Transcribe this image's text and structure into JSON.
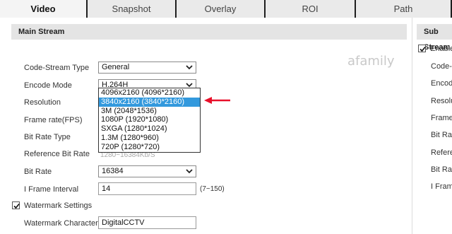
{
  "tabs": [
    "Video",
    "Snapshot",
    "Overlay",
    "ROI",
    "Path"
  ],
  "main_stream": {
    "title": "Main Stream",
    "code_stream_type": {
      "label": "Code-Stream Type",
      "value": "General"
    },
    "encode_mode": {
      "label": "Encode Mode",
      "value": "H.264H"
    },
    "resolution": {
      "label": "Resolution"
    },
    "frame_rate": {
      "label": "Frame rate(FPS)"
    },
    "bit_rate_type": {
      "label": "Bit Rate Type"
    },
    "reference_bit_rate": {
      "label": "Reference Bit Rate",
      "value": "1280~16384Kb/S"
    },
    "bit_rate": {
      "label": "Bit Rate",
      "value": "16384"
    },
    "i_frame_interval": {
      "label": "I Frame Interval",
      "value": "14",
      "range": "(7~150)"
    },
    "watermark_settings": {
      "label": "Watermark Settings",
      "checked": true
    },
    "watermark_character": {
      "label": "Watermark Character",
      "value": "DigitalCCTV"
    }
  },
  "resolution_options": [
    "4096x2160 (4096*2160)",
    "3840x2160 (3840*2160)",
    "3M (2048*1536)",
    "1080P (1920*1080)",
    "SXGA (1280*1024)",
    "1.3M (1280*960)",
    "720P (1280*720)"
  ],
  "sub_stream": {
    "title": "Sub Stream",
    "enable_label": "Enable",
    "labels": [
      "Code-S",
      "Encode",
      "Resolu",
      "Frame",
      "Bit Rat",
      "Refere",
      "Bit Rat",
      "I Frame"
    ]
  },
  "watermark_logo": "afamily",
  "colors": {
    "accent_selected": "#3399dd",
    "arrow": "#e8102a",
    "tabbar": "#1e1e1e"
  }
}
